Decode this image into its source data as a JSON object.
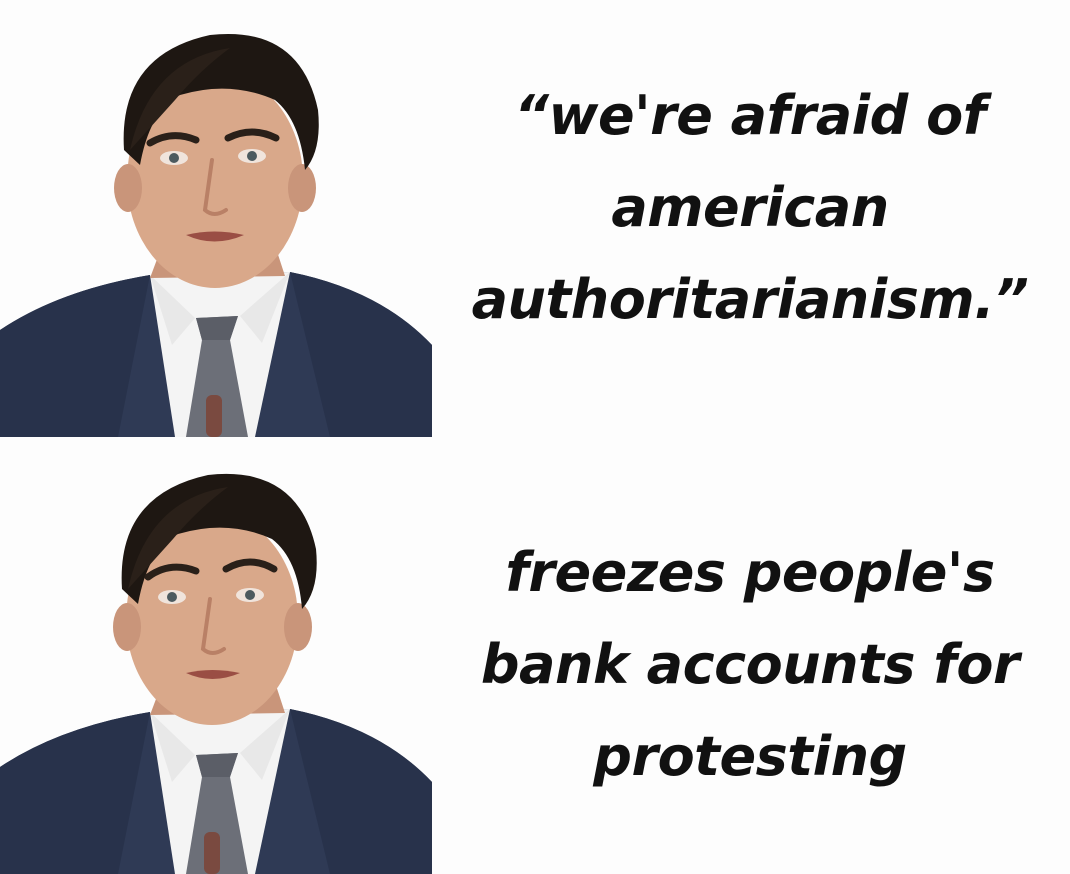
{
  "meme": {
    "top_panel": {
      "caption_lines": [
        "“we're afraid of",
        "american",
        "authoritarianism.”"
      ]
    },
    "bottom_panel": {
      "caption_lines": [
        "freezes people's",
        "bank accounts for",
        "protesting"
      ]
    }
  },
  "colors": {
    "background": "#fdfdfd",
    "text": "#111111",
    "suit": "#2f3a55",
    "shirt": "#f4f4f4",
    "tie": "#6c6f78",
    "hair": "#1e1712",
    "skin": "#d9a88a"
  }
}
